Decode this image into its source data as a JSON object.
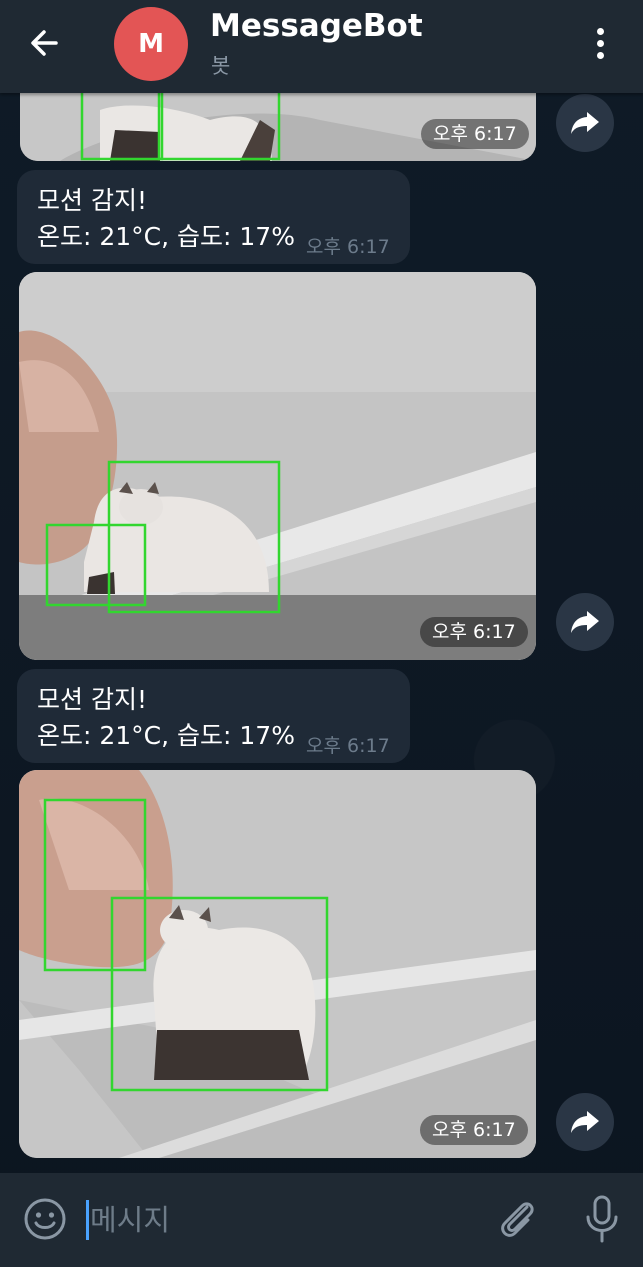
{
  "header": {
    "title": "MessageBot",
    "subtitle": "봇",
    "avatar_letter": "M",
    "avatar_color": "#e35555"
  },
  "messages": [
    {
      "type": "photo",
      "time": "오후 6:17"
    },
    {
      "type": "text",
      "line1": "모션 감지!",
      "line2": "온도: 21°C, 습도: 17%",
      "time": "오후 6:17"
    },
    {
      "type": "photo",
      "time": "오후 6:17"
    },
    {
      "type": "text",
      "line1": "모션 감지!",
      "line2": "온도: 21°C, 습도: 17%",
      "time": "오후 6:17"
    },
    {
      "type": "photo",
      "time": "오후 6:17"
    }
  ],
  "input": {
    "placeholder": "메시지"
  },
  "icons": {
    "back": "arrow-left-icon",
    "menu": "more-vertical-icon",
    "forward": "share-arrow-icon",
    "emoji": "smile-icon",
    "attach": "paperclip-icon",
    "mic": "microphone-icon"
  },
  "colors": {
    "detection_box": "#32d62f",
    "header_bg": "#1f2933",
    "bubble_bg": "#1f2a37"
  }
}
